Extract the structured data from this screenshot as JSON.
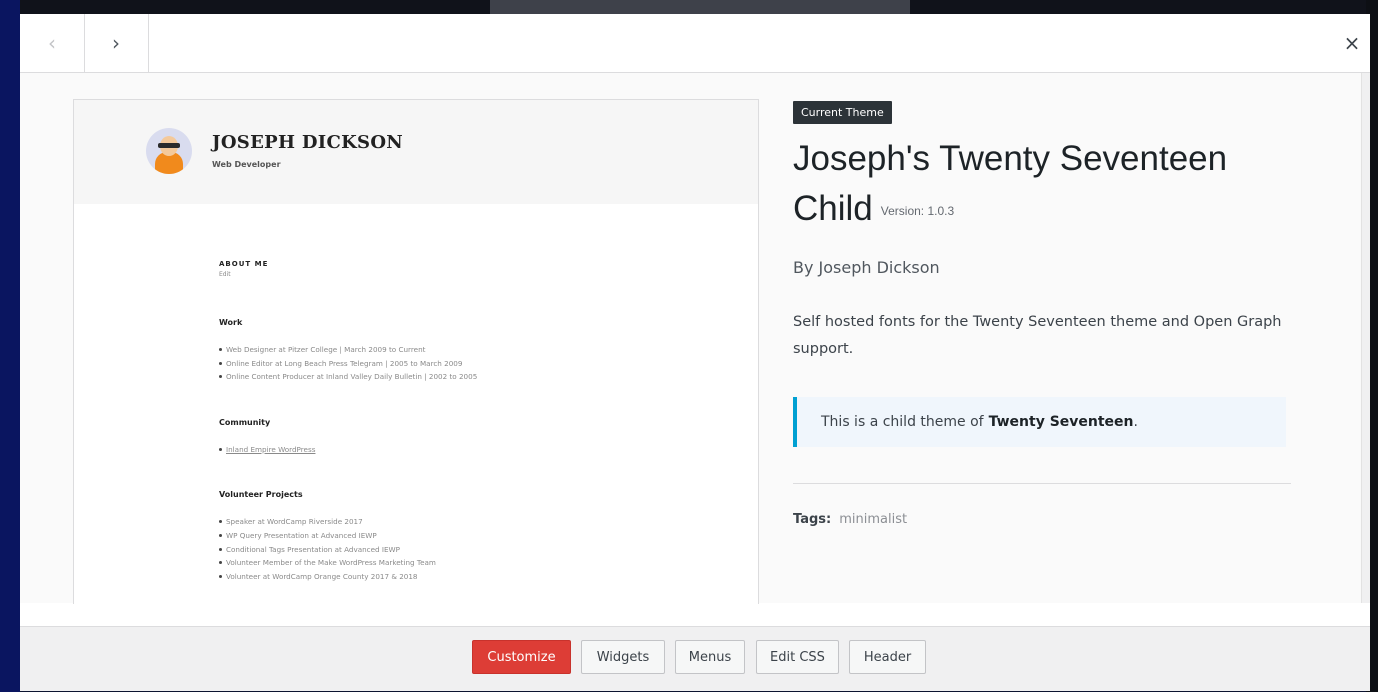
{
  "topbar": {
    "prev_icon": "‹",
    "next_icon": "›",
    "close_icon": "×"
  },
  "preview": {
    "site_name": "JOSEPH DICKSON",
    "site_role": "Web Developer",
    "about_heading": "ABOUT ME",
    "about_edit": "Edit",
    "work_heading": "Work",
    "work_items": [
      "Web Designer at Pitzer College | March 2009 to Current",
      "Online Editor at Long Beach Press Telegram | 2005 to March 2009",
      "Online Content Producer at Inland Valley Daily Bulletin | 2002 to 2005"
    ],
    "community_heading": "Community",
    "community_items": [
      "Inland Empire WordPress"
    ],
    "volunteer_heading": "Volunteer Projects",
    "volunteer_items": [
      "Speaker at WordCamp Riverside 2017",
      "WP Query Presentation at Advanced IEWP",
      "Conditional Tags Presentation at Advanced IEWP",
      "Volunteer Member of the Make WordPress Marketing Team",
      "Volunteer at WordCamp Orange County 2017 & 2018"
    ]
  },
  "theme": {
    "badge": "Current Theme",
    "name": "Joseph's Twenty Seventeen Child",
    "version": "Version: 1.0.3",
    "author": "By Joseph Dickson",
    "description": "Self hosted fonts for the Twenty Seventeen theme and Open Graph support.",
    "notice_prefix": "This is a child theme of",
    "notice_parent": "Twenty Seventeen",
    "notice_suffix": ".",
    "tags_label": "Tags:",
    "tags_value": "minimalist"
  },
  "footer": {
    "buttons": [
      "Customize",
      "Widgets",
      "Menus",
      "Edit CSS",
      "Header"
    ]
  },
  "colors": {
    "primary_button": "#dd3d36",
    "notice_border": "#00a0d2",
    "badge_bg": "#2c3338"
  }
}
